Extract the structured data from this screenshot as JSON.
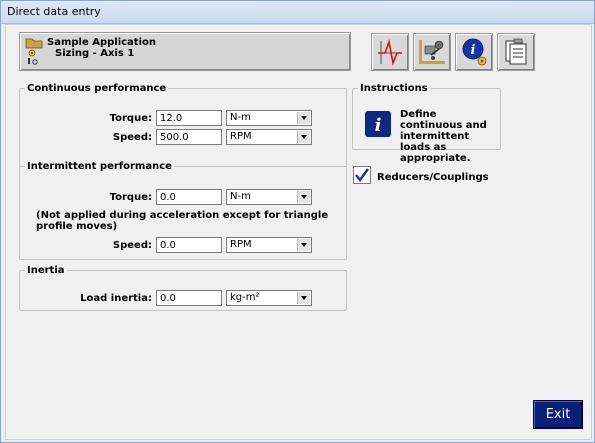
{
  "window": {
    "title": "Direct data entry"
  },
  "header": {
    "line1": "Sample Application",
    "line2": "Sizing - Axis 1"
  },
  "toolbar": {
    "icons": [
      "motion-profile-icon",
      "mechanism-icon",
      "info-settings-icon",
      "report-icon"
    ]
  },
  "continuous": {
    "legend": "Continuous performance",
    "torque_label": "Torque:",
    "torque_value": "12.0",
    "torque_unit": "N-m",
    "speed_label": "Speed:",
    "speed_value": "500.0",
    "speed_unit": "RPM"
  },
  "intermittent": {
    "legend": "Intermittent performance",
    "torque_label": "Torque:",
    "torque_value": "0.0",
    "torque_unit": "N-m",
    "note": "(Not applied during acceleration except for triangle profile moves)",
    "speed_label": "Speed:",
    "speed_value": "0.0",
    "speed_unit": "RPM"
  },
  "inertia": {
    "legend": "Inertia",
    "load_label": "Load inertia:",
    "load_value": "0.0",
    "load_unit": "kg-m²"
  },
  "instructions": {
    "legend": "Instructions",
    "text": "Define continuous and intermittent loads as appropriate.",
    "icon": "info-icon"
  },
  "reducers": {
    "label": "Reducers/Couplings",
    "checked": true
  },
  "exit_label": "Exit",
  "colors": {
    "exit_bg": "#0a1f7a",
    "check": "#1b2fb0",
    "info_bg": "#0d2a80",
    "profile_red": "#d41414"
  }
}
